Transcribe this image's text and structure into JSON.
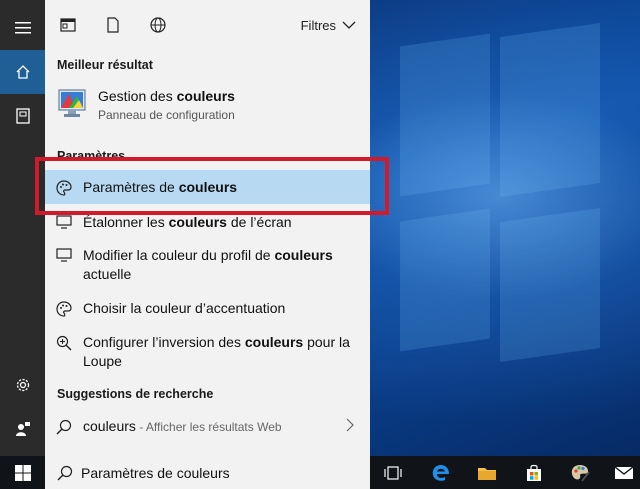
{
  "tabs": {
    "filters_label": "Filtres"
  },
  "best_match": {
    "section": "Meilleur résultat",
    "title_prefix": "Gestion des ",
    "title_bold": "couleurs",
    "subtitle": "Panneau de configuration"
  },
  "settings": {
    "section": "Paramètres",
    "items": [
      {
        "pre": "Paramètres de ",
        "bold": "couleurs",
        "post": ""
      },
      {
        "pre": "Étalonner les ",
        "bold": "couleurs",
        "post": " de l’écran"
      },
      {
        "pre": "Modifier la couleur du profil de ",
        "bold": "couleurs",
        "post": "actuelle"
      },
      {
        "pre": "Choisir la couleur d’accentuation",
        "bold": "",
        "post": ""
      },
      {
        "pre": "Configurer l’inversion des ",
        "bold": "couleurs",
        "post": " pour la",
        "line2": "Loupe"
      }
    ]
  },
  "suggestions": {
    "section": "Suggestions de recherche",
    "query": "couleurs",
    "web_hint": " - Afficher les résultats Web"
  },
  "search": {
    "value": "Paramètres de couleurs"
  },
  "colors": {
    "highlight": "#b8d9f2",
    "annotation": "#d11a2a",
    "rail_active": "#1f5f96"
  }
}
